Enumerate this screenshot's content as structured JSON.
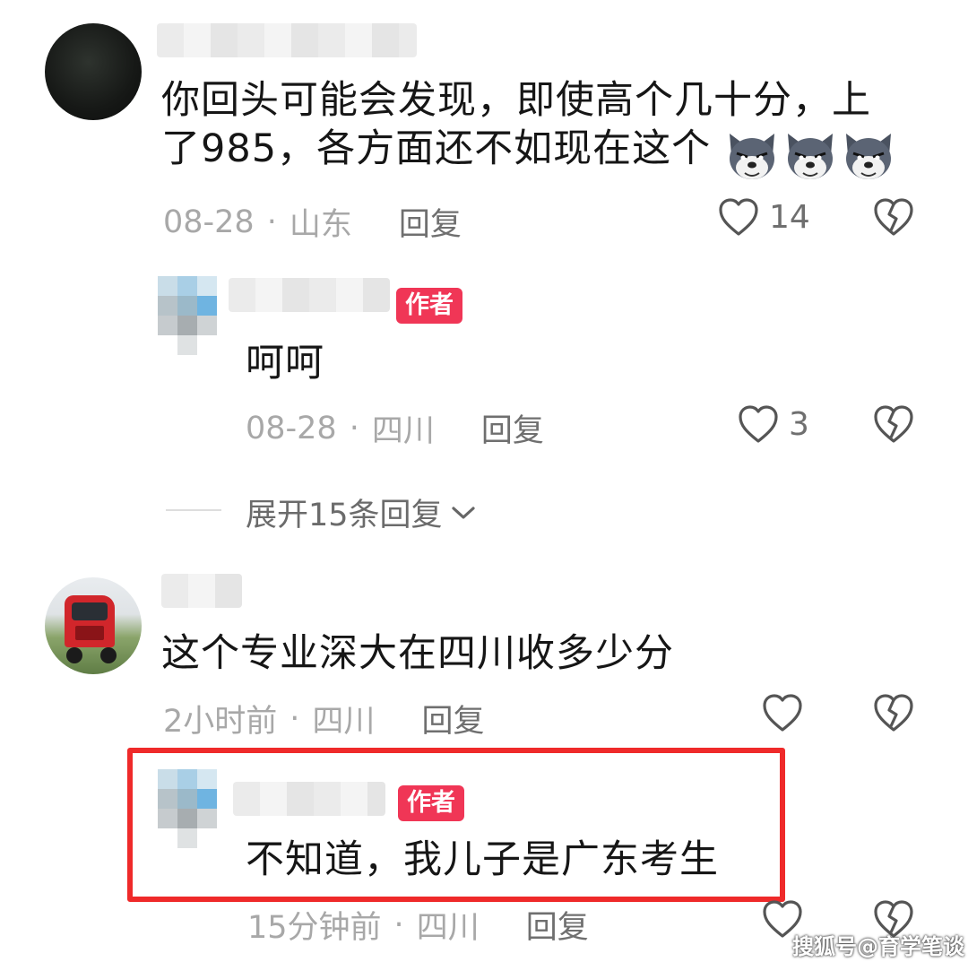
{
  "comments": [
    {
      "text": "你回头可能会发现，即使高个几十分，上了985，各方面还不如现在这个",
      "text_line1": "你回头可能会发现，即使高个几十分，上",
      "text_line2": "了985，各方面还不如现在这个",
      "emoji": "wolf-emoji",
      "date": "08-28",
      "separator": "·",
      "location": "山东",
      "reply_label": "回复",
      "likes": "14",
      "replies": [
        {
          "badge": "作者",
          "text": "呵呵",
          "date": "08-28",
          "separator": "·",
          "location": "四川",
          "reply_label": "回复",
          "likes": "3"
        }
      ],
      "expand_label": "展开15条回复"
    },
    {
      "text": "这个专业深大在四川收多少分",
      "date": "2小时前",
      "separator": "·",
      "location": "四川",
      "reply_label": "回复",
      "likes": "",
      "replies": [
        {
          "badge": "作者",
          "text": "不知道，我儿子是广东考生",
          "date": "15分钟前",
          "separator": "·",
          "location": "四川",
          "reply_label": "回复"
        }
      ]
    }
  ],
  "watermark": "搜狐号@育学笔谈",
  "colors": {
    "badge": "#f03656",
    "highlight": "#ef2a2a"
  }
}
